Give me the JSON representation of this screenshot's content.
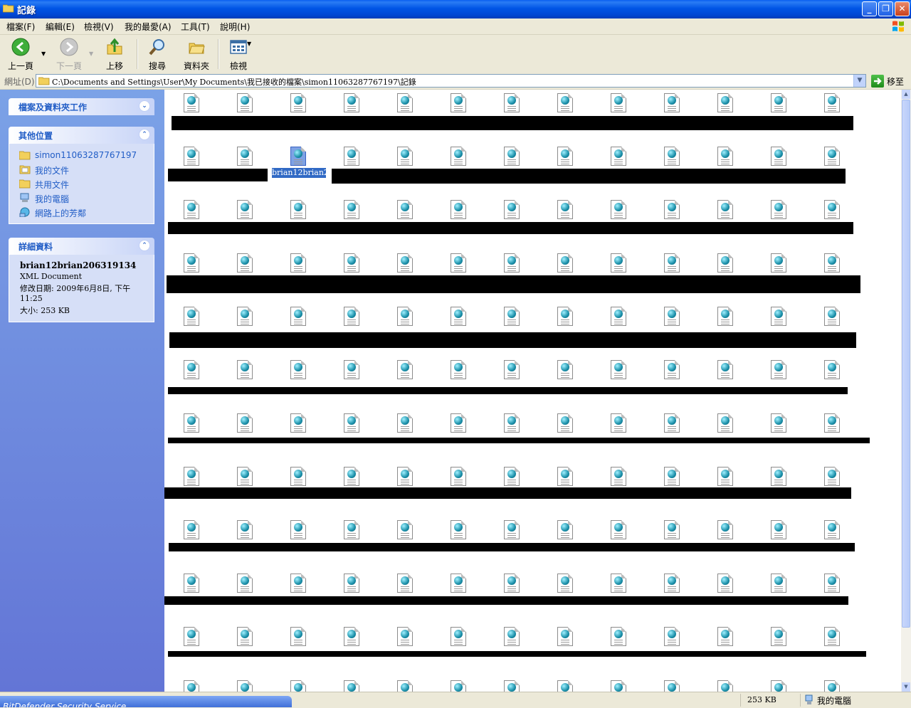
{
  "window": {
    "title": "記錄"
  },
  "menu": [
    "檔案(F)",
    "編輯(E)",
    "檢視(V)",
    "我的最愛(A)",
    "工具(T)",
    "說明(H)"
  ],
  "toolbar": {
    "back": "上一頁",
    "forward": "下一頁",
    "up": "上移",
    "search": "搜尋",
    "folders": "資料夾",
    "views": "檢視"
  },
  "address": {
    "label": "網址(D)",
    "path": "C:\\Documents and Settings\\User\\My Documents\\我已接收的檔案\\simon11063287767197\\記錄",
    "go": "移至"
  },
  "left_pane": {
    "tasks": {
      "title": "檔案及資料夾工作"
    },
    "other_places": {
      "title": "其他位置",
      "items": [
        {
          "label": "simon11063287767197",
          "icon": "folder-icon"
        },
        {
          "label": "我的文件",
          "icon": "documents-icon"
        },
        {
          "label": "共用文件",
          "icon": "folder-icon"
        },
        {
          "label": "我的電腦",
          "icon": "computer-icon"
        },
        {
          "label": "網路上的芳鄰",
          "icon": "network-icon"
        }
      ]
    },
    "details": {
      "title": "詳細資料",
      "name": "brian12brian206319134",
      "type": "XML Document",
      "modified": "修改日期: 2009年6月8日, 下午 11:25",
      "size": "大小: 253 KB"
    }
  },
  "files": {
    "selected_label": "brian12brian206319134",
    "columns": 13,
    "rows": 12
  },
  "status": {
    "size": "253 KB",
    "location": "我的電腦"
  },
  "taskbar": {
    "item": "BitDefender Security Service"
  },
  "colors": {
    "title_blue": "#0055e5",
    "pane_blue": "#6375d6",
    "link_blue": "#215dc6",
    "select_blue": "#316ac5"
  }
}
